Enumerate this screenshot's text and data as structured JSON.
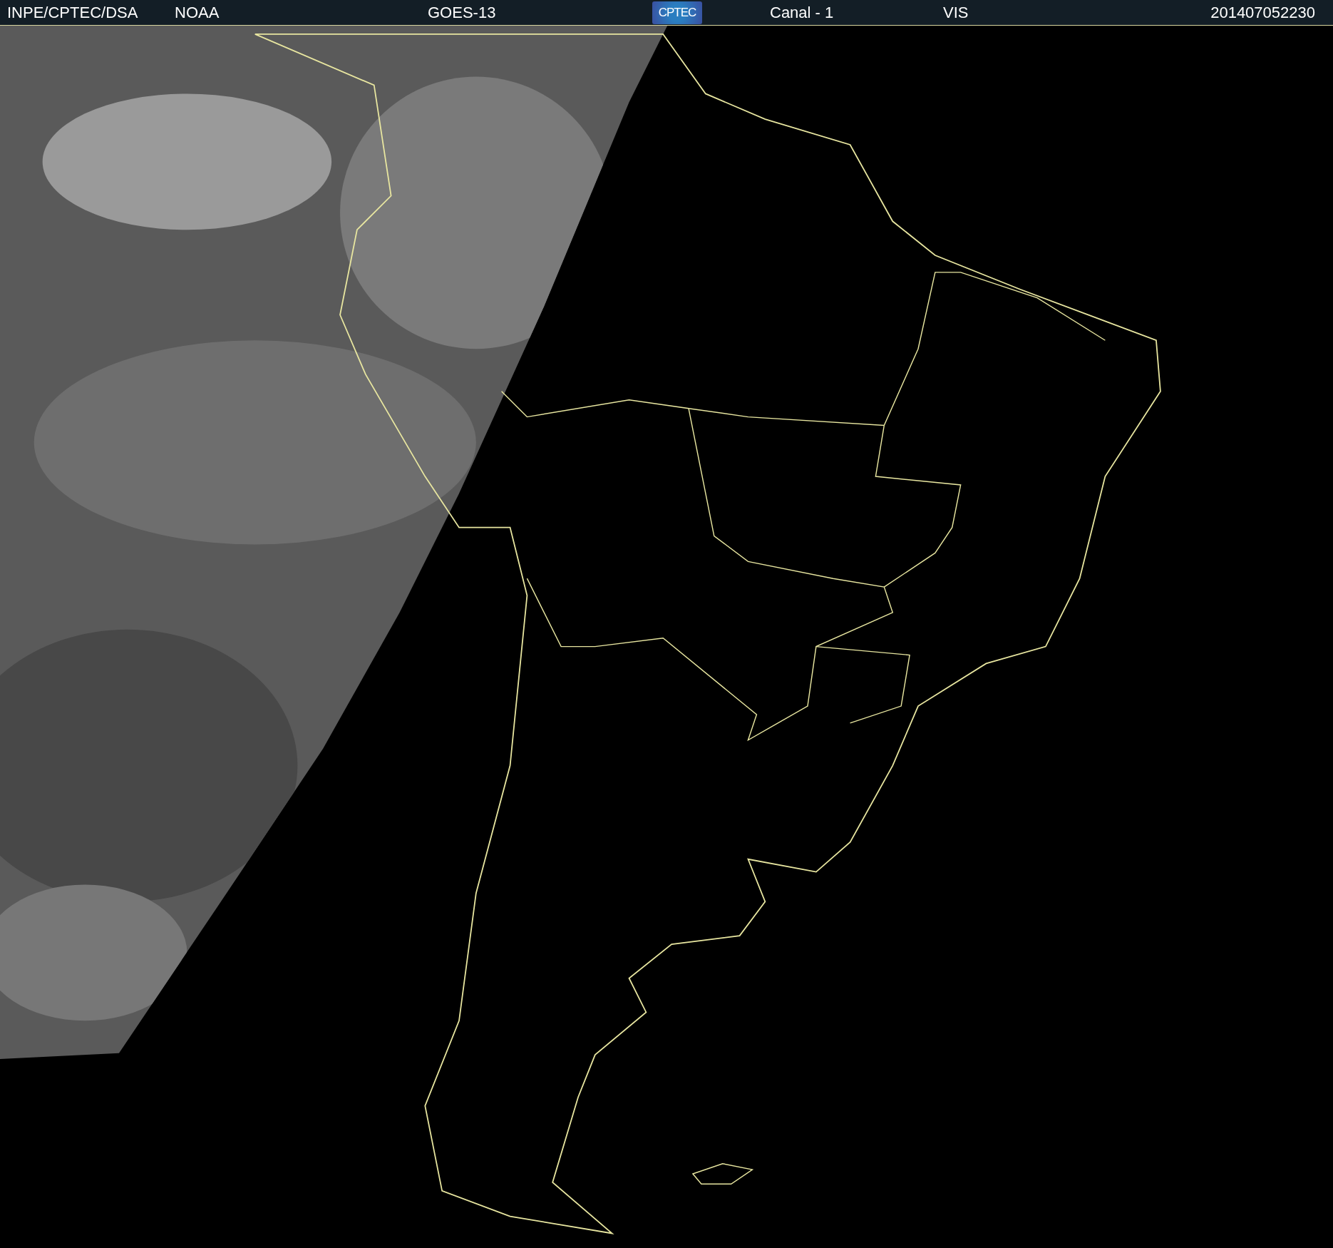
{
  "header": {
    "items": [
      {
        "kind": "text",
        "text": "INPE/CPTEC/DSA"
      },
      {
        "kind": "text",
        "text": "NOAA"
      },
      {
        "kind": "text",
        "text": "GOES-13"
      },
      {
        "kind": "logo",
        "text": "CPTEC"
      },
      {
        "kind": "text",
        "text": "Canal - 1"
      },
      {
        "kind": "text",
        "text": "VIS"
      },
      {
        "kind": "time",
        "text": "201407052230"
      }
    ]
  }
}
